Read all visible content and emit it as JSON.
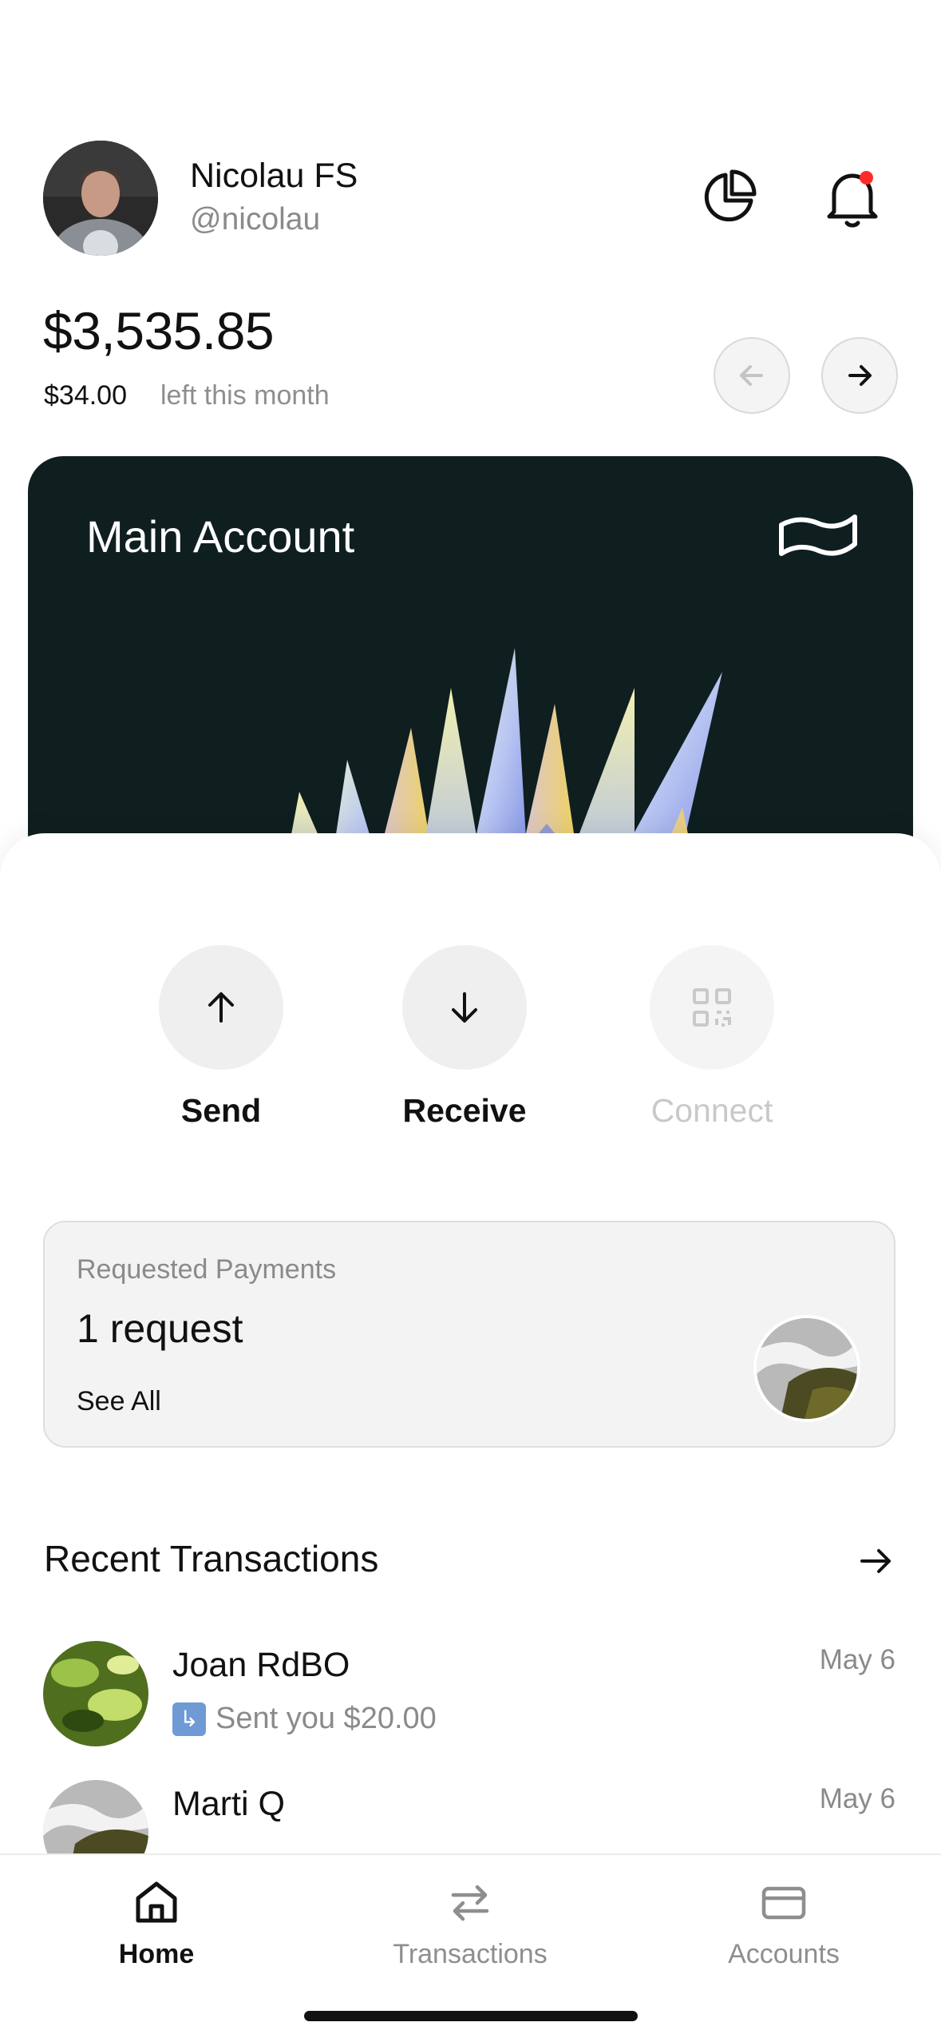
{
  "user": {
    "name": "Nicolau FS",
    "handle": "@nicolau"
  },
  "header_icons": {
    "stats": "pie-chart-icon",
    "notifications": "bell-icon"
  },
  "balance": {
    "amount": "$3,535.85",
    "left_amount": "$34.00",
    "left_label": "left this month"
  },
  "card": {
    "title": "Main Account",
    "flag_icon": "flag-icon",
    "bg_color": "#0f1f20"
  },
  "actions": [
    {
      "label": "Send",
      "icon": "arrow-up-icon",
      "enabled": true
    },
    {
      "label": "Receive",
      "icon": "arrow-down-icon",
      "enabled": true
    },
    {
      "label": "Connect",
      "icon": "qr-code-icon",
      "enabled": false
    }
  ],
  "requests": {
    "label": "Requested Payments",
    "count": "1 request",
    "link": "See All"
  },
  "recent": {
    "title": "Recent Transactions",
    "items": [
      {
        "name": "Joan RdBO",
        "detail": "Sent you $20.00",
        "date": "May 6"
      },
      {
        "name": "Marti Q",
        "detail": "",
        "date": "May 6"
      }
    ]
  },
  "tabs": [
    {
      "label": "Home",
      "icon": "home-icon",
      "active": true
    },
    {
      "label": "Transactions",
      "icon": "swap-arrows-icon",
      "active": false
    },
    {
      "label": "Accounts",
      "icon": "card-icon",
      "active": false
    }
  ],
  "colors": {
    "accent": "#111111",
    "notification_dot": "#ff2b2b",
    "muted": "#8a8a8a"
  }
}
